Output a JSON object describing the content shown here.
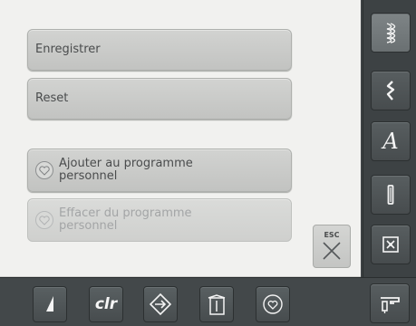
{
  "menu": {
    "save_label": "Enregistrer",
    "reset_label": "Reset",
    "add_line1": "Ajouter au programme",
    "add_line2": "personnel",
    "remove_line1": "Effacer du programme",
    "remove_line2": "personnel"
  },
  "esc": {
    "label": "ESC"
  },
  "sidebar": {
    "items": [
      {
        "icon": "stitch-pattern-icon",
        "active": true
      },
      {
        "icon": "zigzag-stitch-icon",
        "active": false
      },
      {
        "icon": "alphabet-icon",
        "glyph": "A",
        "active": false
      },
      {
        "icon": "buttonhole-icon",
        "active": false
      },
      {
        "icon": "quilt-stitch-icon",
        "active": false
      },
      {
        "icon": "sewing-machine-icon",
        "active": false
      }
    ]
  },
  "bottombar": {
    "clr_label": "clr",
    "items": [
      "stitch-alteration-icon",
      "clear-icon",
      "navigation-icon",
      "tutorial-icon",
      "personal-program-icon"
    ]
  },
  "colors": {
    "panel": "#f1f1ef",
    "button": "#c8c9c7",
    "dark_frame": "#3f4446",
    "icon": "#f2f2f2"
  }
}
